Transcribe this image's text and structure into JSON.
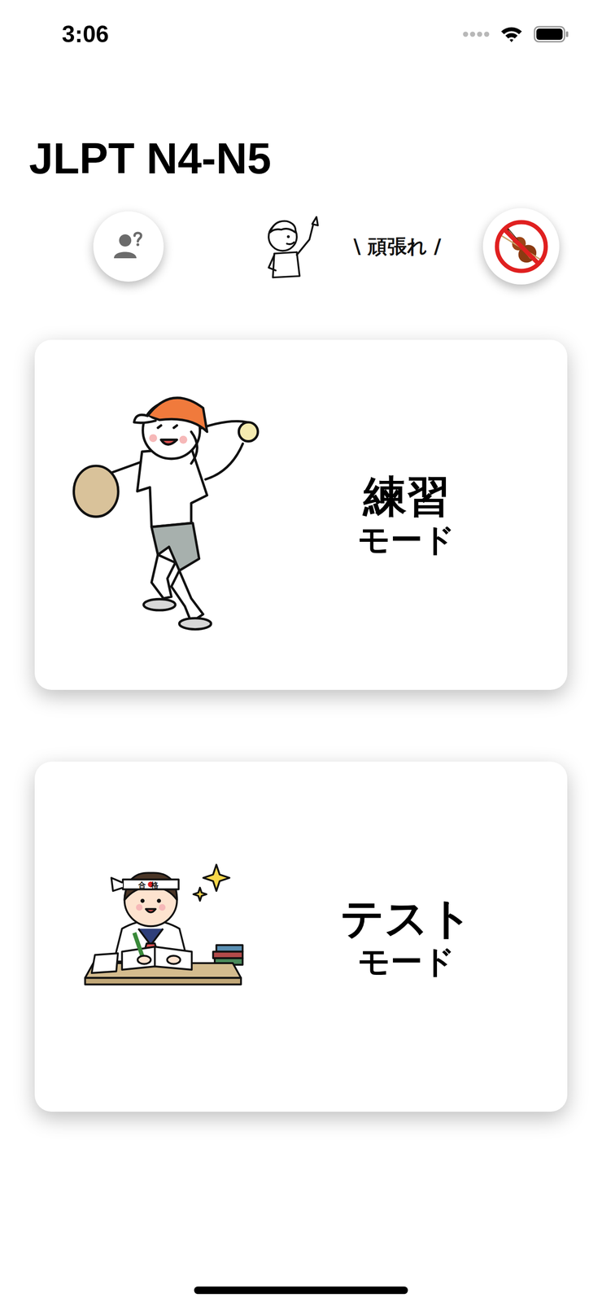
{
  "status_bar": {
    "time": "3:06",
    "signal": {
      "level": 0
    },
    "battery": {
      "level": 1
    }
  },
  "title": "JLPT N4-N5",
  "header": {
    "cheer": "\\ 頑張れ /",
    "sound_muted": true
  },
  "modes": [
    {
      "title": "練習",
      "subtitle": "モード",
      "kind": "practice",
      "headband": ""
    },
    {
      "title": "テスト",
      "subtitle": "モード",
      "kind": "test",
      "headband": "合格"
    }
  ]
}
